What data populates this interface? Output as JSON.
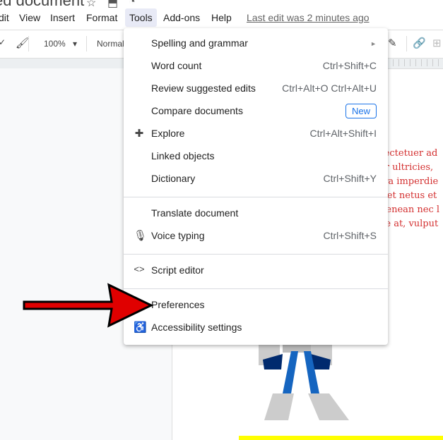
{
  "title": "ed document",
  "menubar": {
    "items": [
      "dit",
      "View",
      "Insert",
      "Format",
      "Tools",
      "Add-ons",
      "Help"
    ],
    "last_edit": "Last edit was 2 minutes ago"
  },
  "toolbar": {
    "zoom": "100%",
    "style": "Normal"
  },
  "document": {
    "red_lines": [
      "sectetuer ad",
      "ar ultricies,",
      "rra imperdie",
      "s et netus et",
      "Aenean nec l",
      "ue at, vulput"
    ]
  },
  "menu": {
    "items": [
      {
        "label": "Spelling and grammar",
        "shortcut": "►"
      },
      {
        "label": "Word count",
        "shortcut": "Ctrl+Shift+C"
      },
      {
        "label": "Review suggested edits",
        "shortcut": "Ctrl+Alt+O Ctrl+Alt+U"
      },
      {
        "label": "Compare documents",
        "badge": "New"
      },
      {
        "label": "Explore",
        "shortcut": "Ctrl+Alt+Shift+I",
        "icon": "explore-icon"
      },
      {
        "label": "Linked objects"
      },
      {
        "label": "Dictionary",
        "shortcut": "Ctrl+Shift+Y"
      },
      {
        "label": "Translate document"
      },
      {
        "label": "Voice typing",
        "shortcut": "Ctrl+Shift+S",
        "icon": "microphone-icon"
      },
      {
        "label": "Script editor",
        "icon": "code-icon"
      },
      {
        "label": "Preferences"
      },
      {
        "label": "Accessibility settings",
        "icon": "accessibility-icon"
      }
    ]
  },
  "colors": {
    "accent": "#1a73e8",
    "arrow": "#e00000",
    "doc_text": "#d32f2f"
  }
}
